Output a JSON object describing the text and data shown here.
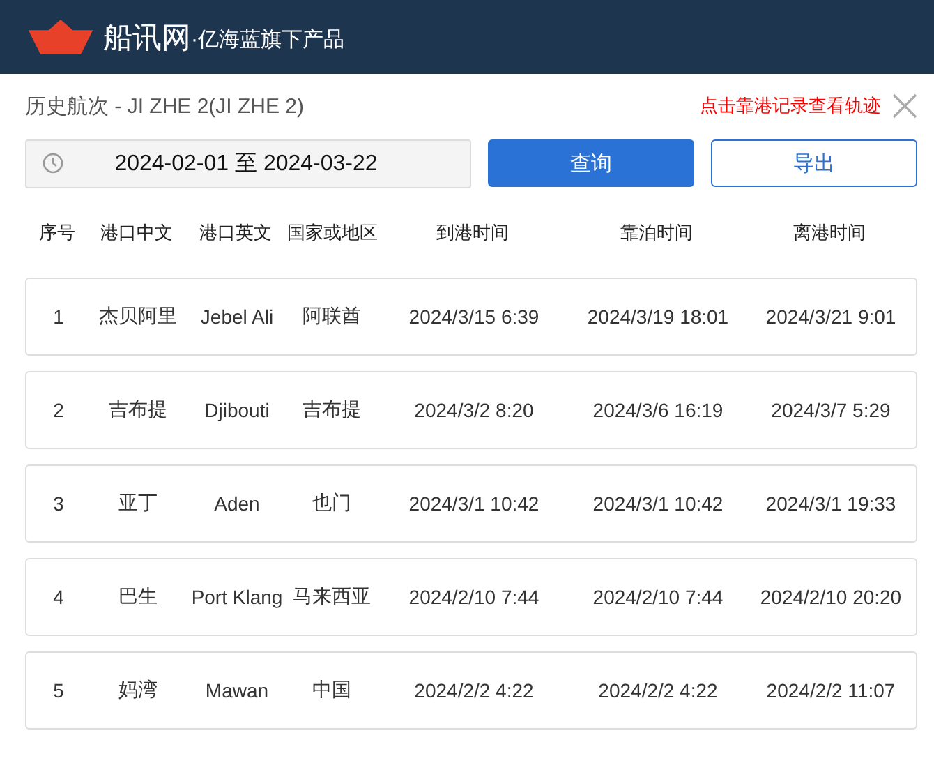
{
  "header": {
    "brand": "船讯网",
    "tagline": "·亿海蓝旗下产品"
  },
  "title": "历史航次 - JI ZHE 2(JI ZHE 2)",
  "hint": "点击靠港记录查看轨迹",
  "date_range": {
    "value": "2024-02-01 至 2024-03-22"
  },
  "buttons": [
    {
      "label": "查询",
      "kind": "primary"
    },
    {
      "label": "导出",
      "kind": "outline"
    }
  ],
  "table": {
    "columns": [
      "序号",
      "港口中文",
      "港口英文",
      "国家或地区",
      "到港时间",
      "靠泊时间",
      "离港时间"
    ],
    "rows": [
      [
        "1",
        "杰贝阿里",
        "Jebel Ali",
        "阿联酋",
        "2024/3/15 6:39",
        "2024/3/19 18:01",
        "2024/3/21 9:01"
      ],
      [
        "2",
        "吉布提",
        "Djibouti",
        "吉布提",
        "2024/3/2 8:20",
        "2024/3/6 16:19",
        "2024/3/7 5:29"
      ],
      [
        "3",
        "亚丁",
        "Aden",
        "也门",
        "2024/3/1 10:42",
        "2024/3/1 10:42",
        "2024/3/1 19:33"
      ],
      [
        "4",
        "巴生",
        "Port Klang",
        "马来西亚",
        "2024/2/10 7:44",
        "2024/2/10 7:44",
        "2024/2/10 20:20"
      ],
      [
        "5",
        "妈湾",
        "Mawan",
        "中国",
        "2024/2/2 4:22",
        "2024/2/2 4:22",
        "2024/2/2 11:07"
      ]
    ]
  }
}
